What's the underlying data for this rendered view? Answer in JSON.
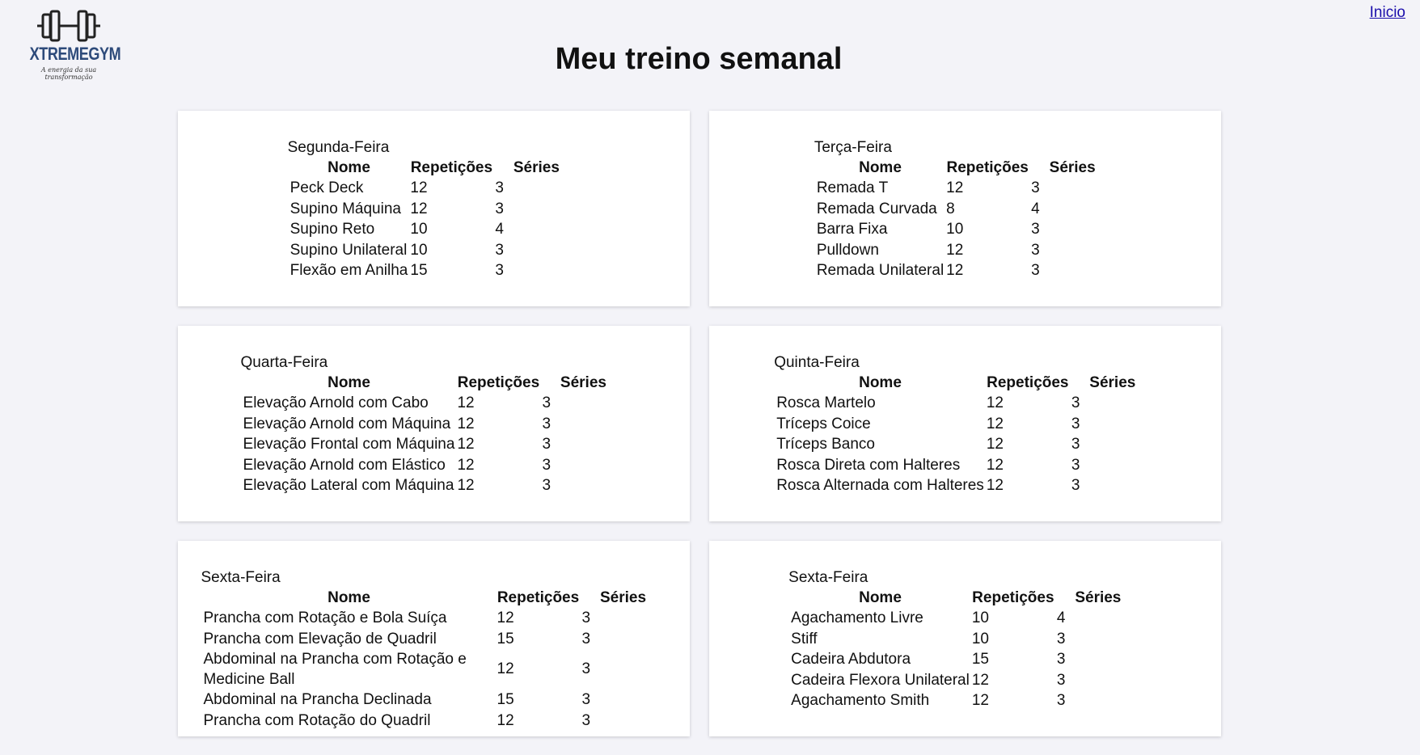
{
  "header": {
    "logo_text": "XTREMEGYM",
    "logo_tagline": "A energia da sua transformação",
    "home_link": "Inicio",
    "title": "Meu treino semanal"
  },
  "columns": [
    "Nome",
    "Repetições",
    "Séries"
  ],
  "days": [
    {
      "day": "Segunda-Feira",
      "rows": [
        [
          "Peck Deck",
          "12",
          "3"
        ],
        [
          "Supino Máquina",
          "12",
          "3"
        ],
        [
          "Supino Reto",
          "10",
          "4"
        ],
        [
          "Supino Unilateral",
          "10",
          "3"
        ],
        [
          "Flexão em Anilha",
          "15",
          "3"
        ]
      ]
    },
    {
      "day": "Terça-Feira",
      "rows": [
        [
          "Remada T",
          "12",
          "3"
        ],
        [
          "Remada Curvada",
          "8",
          "4"
        ],
        [
          "Barra Fixa",
          "10",
          "3"
        ],
        [
          "Pulldown",
          "12",
          "3"
        ],
        [
          "Remada Unilateral",
          "12",
          "3"
        ]
      ]
    },
    {
      "day": "Quarta-Feira",
      "rows": [
        [
          "Elevação Arnold com Cabo",
          "12",
          "3"
        ],
        [
          "Elevação Arnold com Máquina",
          "12",
          "3"
        ],
        [
          "Elevação Frontal com Máquina",
          "12",
          "3"
        ],
        [
          "Elevação Arnold com Elástico",
          "12",
          "3"
        ],
        [
          "Elevação Lateral com Máquina",
          "12",
          "3"
        ]
      ]
    },
    {
      "day": "Quinta-Feira",
      "rows": [
        [
          "Rosca Martelo",
          "12",
          "3"
        ],
        [
          "Tríceps Coice",
          "12",
          "3"
        ],
        [
          "Tríceps Banco",
          "12",
          "3"
        ],
        [
          "Rosca Direta com Halteres",
          "12",
          "3"
        ],
        [
          "Rosca Alternada com Halteres",
          "12",
          "3"
        ]
      ]
    },
    {
      "day": "Sexta-Feira",
      "rows": [
        [
          "Prancha com Rotação e Bola Suíça",
          "12",
          "3"
        ],
        [
          "Prancha com Elevação de Quadril",
          "15",
          "3"
        ],
        [
          "Abdominal na Prancha com Rotação e Medicine Ball",
          "12",
          "3"
        ],
        [
          "Abdominal na Prancha Declinada",
          "15",
          "3"
        ],
        [
          "Prancha com Rotação do Quadril",
          "12",
          "3"
        ]
      ]
    },
    {
      "day": "Sexta-Feira",
      "rows": [
        [
          "Agachamento Livre",
          "10",
          "4"
        ],
        [
          "Stiff",
          "10",
          "3"
        ],
        [
          "Cadeira Abdutora",
          "15",
          "3"
        ],
        [
          "Cadeira Flexora Unilateral",
          "12",
          "3"
        ],
        [
          "Agachamento Smith",
          "12",
          "3"
        ]
      ]
    }
  ]
}
